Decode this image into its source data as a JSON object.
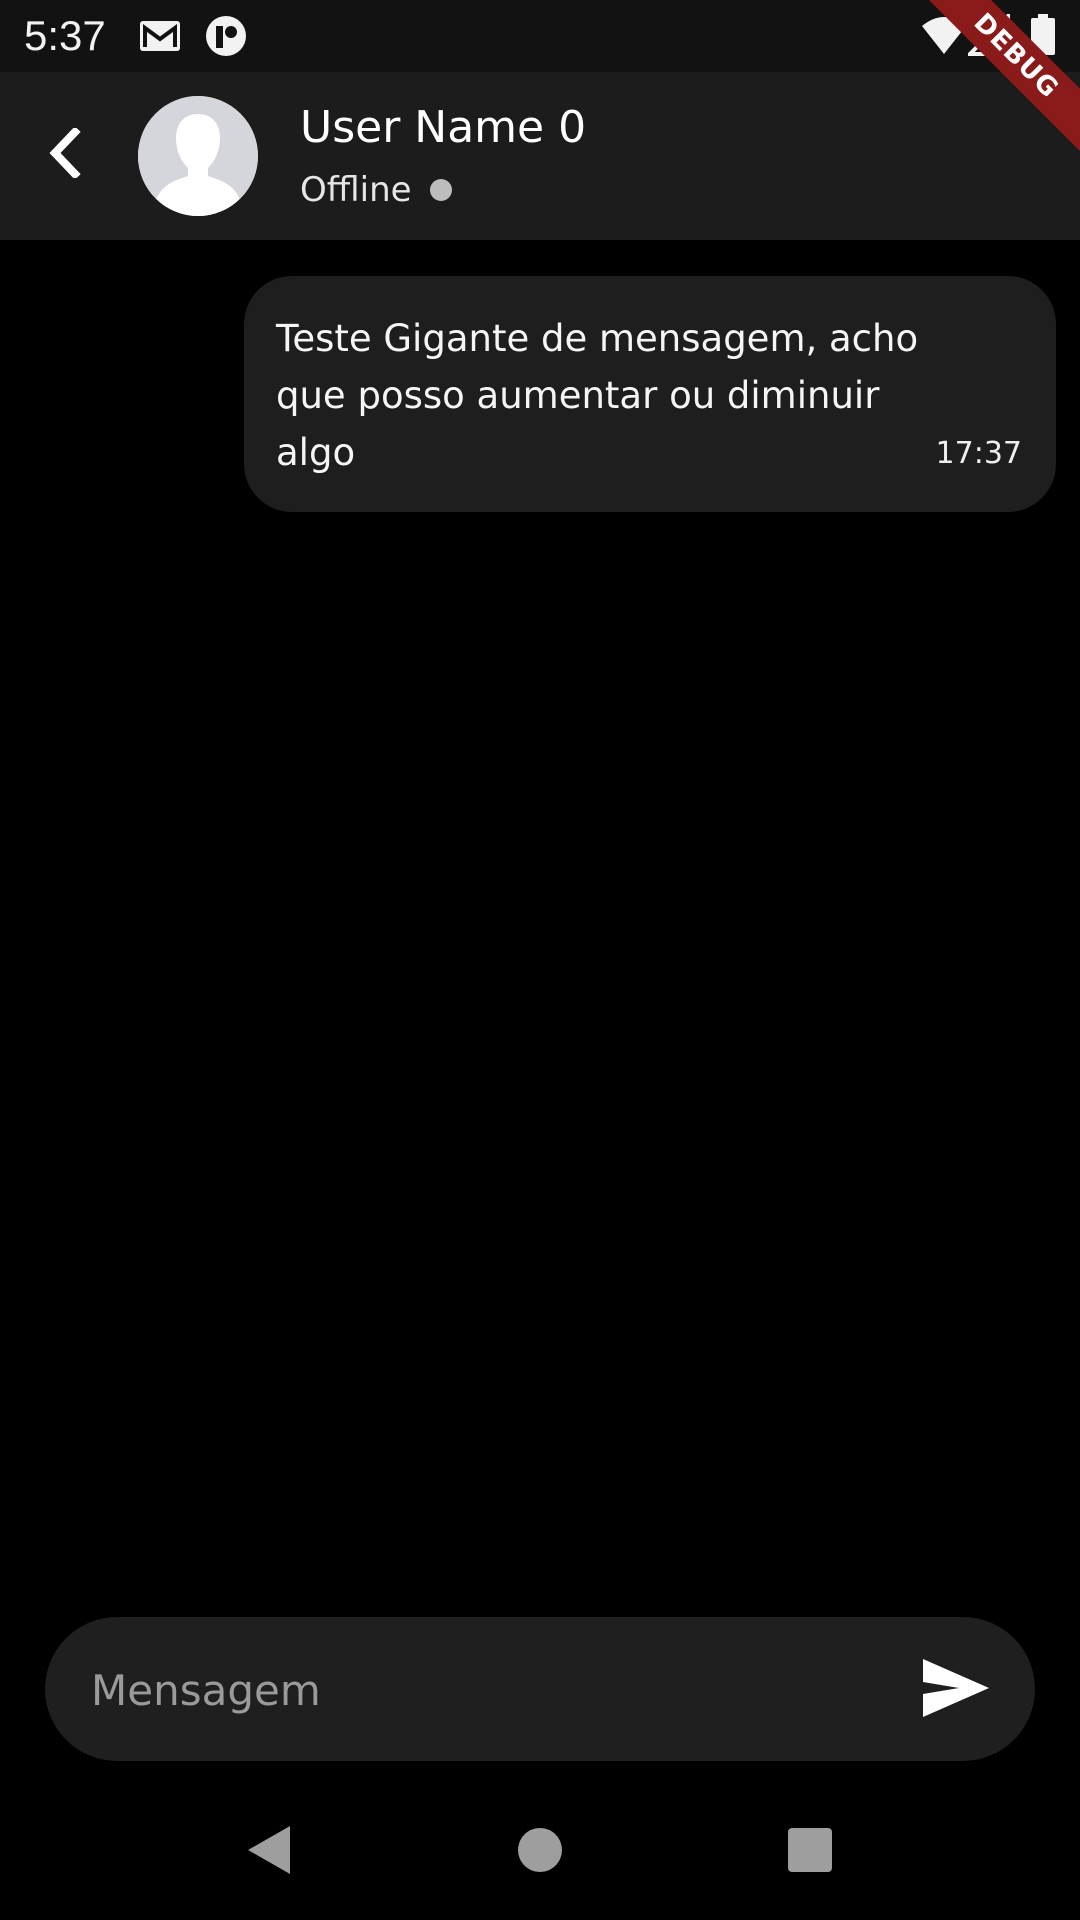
{
  "status_bar": {
    "time": "5:37",
    "icons": [
      "gmail-icon",
      "app-notification-icon",
      "wifi-icon",
      "signal-icon",
      "battery-icon"
    ]
  },
  "debug_banner": "DEBUG",
  "header": {
    "back_icon": "chevron-left-icon",
    "avatar_icon": "default-avatar-icon",
    "name": "User Name 0",
    "status": "Offline",
    "status_color": "#bdbdbd"
  },
  "messages": [
    {
      "text": "Teste Gigante de mensagem, acho que posso aumentar ou diminuir algo",
      "time": "17:37",
      "sent": true
    }
  ],
  "composer": {
    "placeholder": "Mensagem",
    "value": "",
    "send_icon": "send-icon"
  },
  "nav_bar": {
    "icons": [
      "back-triangle-icon",
      "home-circle-icon",
      "recents-square-icon"
    ]
  },
  "colors": {
    "background": "#000000",
    "app_bar": "#1c1c1c",
    "bubble": "#1e1e1e",
    "input": "#1f1f1f",
    "debug": "#8b1a1a"
  }
}
